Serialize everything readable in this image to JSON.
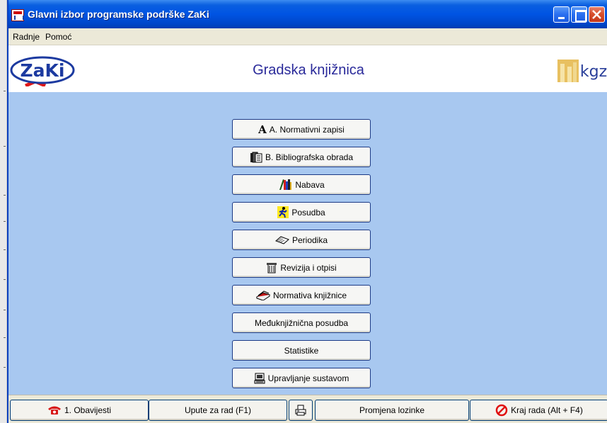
{
  "window": {
    "title": "Glavni izbor programske podrške ZaKi"
  },
  "menubar": {
    "items": [
      "Radnje",
      "Pomoć"
    ]
  },
  "header": {
    "heading": "Gradska knjižnica",
    "logo_left_text": "ZaKi",
    "logo_right_text": "kgz"
  },
  "main_menu": {
    "buttons": [
      {
        "label": "A. Normativni zapisi",
        "icon": "letter-a-icon"
      },
      {
        "label": "B. Bibliografska obrada",
        "icon": "documents-icon"
      },
      {
        "label": "Nabava",
        "icon": "books-icon"
      },
      {
        "label": "Posudba",
        "icon": "running-man-icon"
      },
      {
        "label": "Periodika",
        "icon": "open-book-icon"
      },
      {
        "label": "Revizija i otpisi",
        "icon": "trash-bin-icon"
      },
      {
        "label": "Normativa knjižnice",
        "icon": "book-stack-icon"
      },
      {
        "label": "Međuknjižnična posudba",
        "icon": ""
      },
      {
        "label": "Statistike",
        "icon": ""
      },
      {
        "label": "Upravljanje sustavom",
        "icon": "computer-icon"
      }
    ]
  },
  "bottom_bar": {
    "notifications_label": "1. Obavijesti",
    "manual_label": "Upute za rad (F1)",
    "change_password_label": "Promjena lozinke",
    "exit_label": "Kraj rada (Alt + F4)"
  },
  "colors": {
    "titlebar": "#0054e3",
    "main_background": "#a8c8f0",
    "heading_text": "#2a2a9a"
  }
}
